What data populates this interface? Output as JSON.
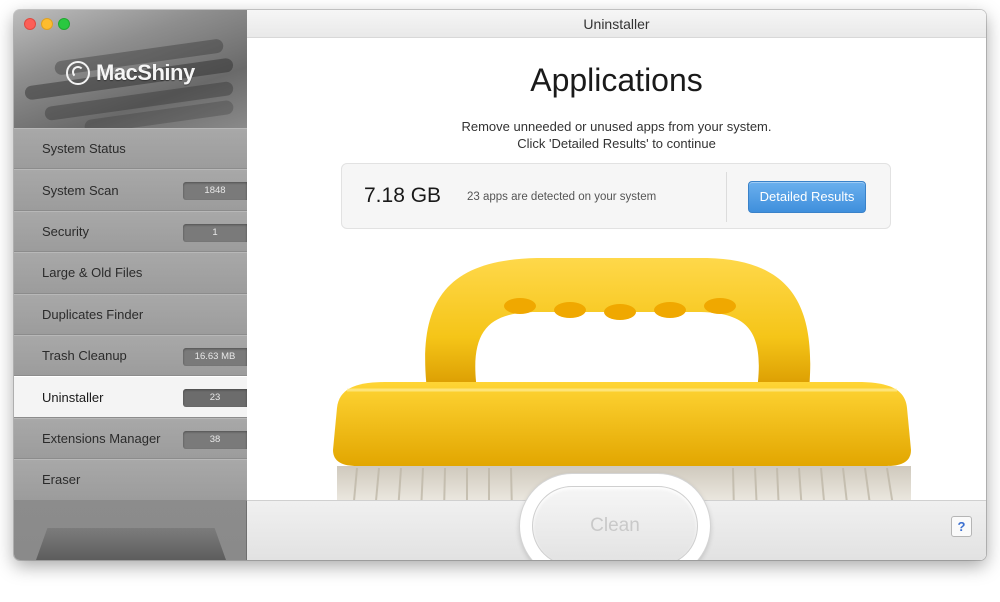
{
  "window": {
    "title": "Uninstaller"
  },
  "brand": {
    "name": "MacShiny"
  },
  "sidebar": {
    "items": [
      {
        "label": "System Status",
        "badge": ""
      },
      {
        "label": "System Scan",
        "badge": "1848"
      },
      {
        "label": "Security",
        "badge": "1"
      },
      {
        "label": "Large & Old Files",
        "badge": ""
      },
      {
        "label": "Duplicates Finder",
        "badge": ""
      },
      {
        "label": "Trash Cleanup",
        "badge": "16.63 MB"
      },
      {
        "label": "Uninstaller",
        "badge": "23",
        "active": true
      },
      {
        "label": "Extensions Manager",
        "badge": "38"
      },
      {
        "label": "Eraser",
        "badge": ""
      }
    ]
  },
  "main": {
    "title": "Applications",
    "description_line1": "Remove unneeded or unused apps from your system.",
    "description_line2": "Click 'Detailed Results' to continue",
    "size": "7.18 GB",
    "apps_text": "23 apps are detected on your system",
    "detail_button": "Detailed Results",
    "clean_button": "Clean",
    "help_button": "?"
  },
  "colors": {
    "accent_blue": "#4a97e0",
    "brush_yellow": "#f5c518",
    "brush_orange": "#f0a800"
  },
  "icons": {
    "logo": "macshiny-logo-icon",
    "illustration": "scrub-brush-illustration"
  }
}
